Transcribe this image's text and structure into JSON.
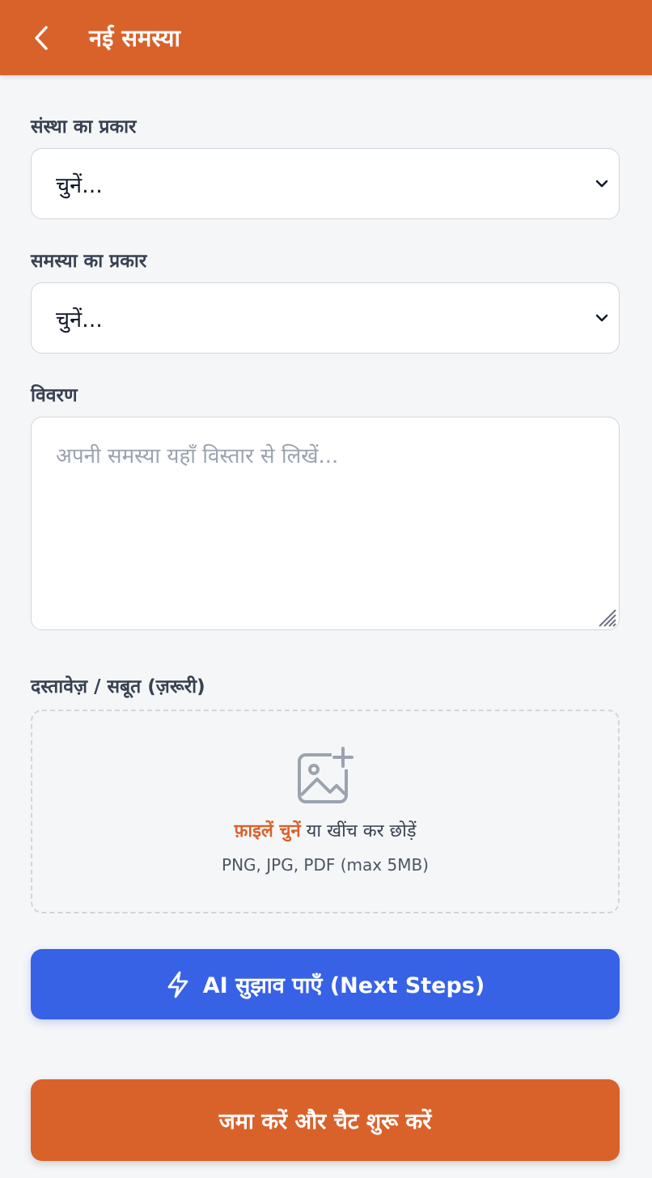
{
  "header": {
    "title": "नई समस्या",
    "back_icon": "chevron-left-icon"
  },
  "form": {
    "org_type": {
      "label": "संस्था का प्रकार",
      "value": "चुनें..."
    },
    "problem_type": {
      "label": "समस्या का प्रकार",
      "value": "चुनें..."
    },
    "description": {
      "label": "विवरण",
      "placeholder": "अपनी समस्या यहाँ विस्तार से लिखें..."
    },
    "documents": {
      "label": "दस्तावेज़ / सबूत (ज़रूरी)",
      "choose_link": "फ़ाइलें चुनें",
      "drag_text": " या खींच कर छोड़ें",
      "hint": "PNG, JPG, PDF (max 5MB)",
      "icon": "image-plus-icon"
    }
  },
  "actions": {
    "ai_label": "AI सुझाव पाएँ (Next Steps)",
    "ai_icon": "lightning-icon",
    "submit_label": "जमा करें और चैट शुरू करें"
  },
  "colors": {
    "brand": "#d9622b",
    "ai_button": "#3762e6",
    "background": "#f5f6f8"
  }
}
